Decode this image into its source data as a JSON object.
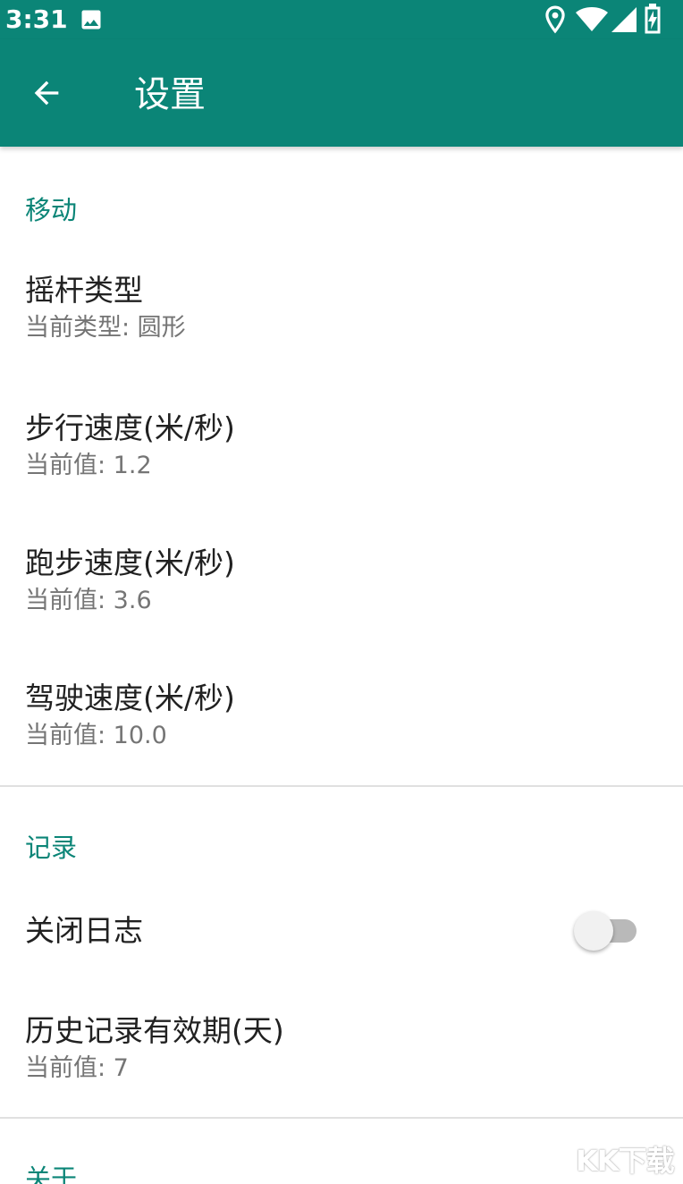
{
  "status_bar": {
    "time": "3:31",
    "left_icons": [
      "image-icon"
    ],
    "right_icons": [
      "location-icon",
      "wifi-icon",
      "signal-icon",
      "battery-charging-icon"
    ]
  },
  "app_bar": {
    "back_icon": "arrow-back-icon",
    "title": "设置"
  },
  "sections": {
    "movement": {
      "header": "移动",
      "items": [
        {
          "title": "摇杆类型",
          "summary": "当前类型: 圆形"
        },
        {
          "title": "步行速度(米/秒)",
          "summary": "当前值: 1.2"
        },
        {
          "title": "跑步速度(米/秒)",
          "summary": "当前值: 3.6"
        },
        {
          "title": "驾驶速度(米/秒)",
          "summary": "当前值: 10.0"
        }
      ]
    },
    "record": {
      "header": "记录",
      "close_log": {
        "title": "关闭日志",
        "switch_on": false
      },
      "history": {
        "title": "历史记录有效期(天)",
        "summary": "当前值: 7"
      }
    },
    "about": {
      "header": "关于"
    }
  },
  "watermark": "KK下载",
  "colors": {
    "primary": "#0b8577",
    "title_text": "#212121",
    "summary_text": "#757575",
    "divider": "#e0e0e0"
  }
}
